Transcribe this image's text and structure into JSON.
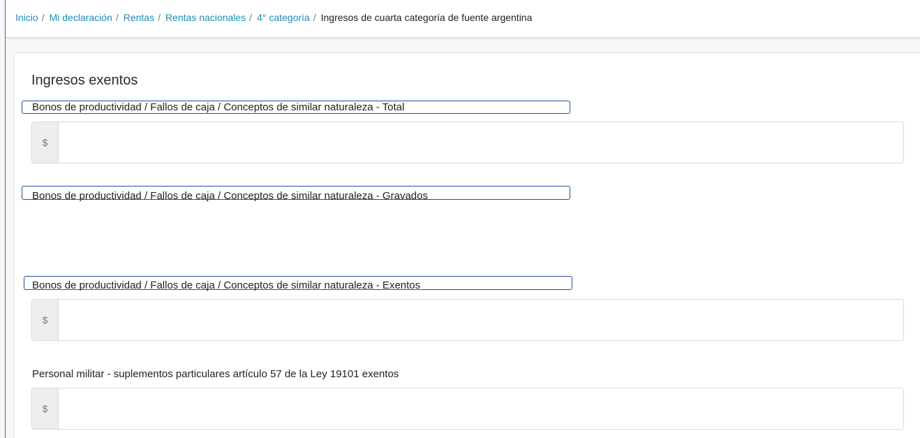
{
  "breadcrumb": {
    "links": [
      "Inicio",
      "Mi declaración",
      "Rentas",
      "Rentas nacionales",
      "4° categoría"
    ],
    "separator": "/",
    "current": "Ingresos de cuarta categoría de fuente argentina"
  },
  "section": {
    "title": "Ingresos exentos"
  },
  "fields": {
    "total": {
      "label": "Bonos de productividad / Fallos de caja / Conceptos de similar naturaleza - Total",
      "currency": "$",
      "value": ""
    },
    "gravados": {
      "label": "Bonos de productividad / Fallos de caja / Conceptos de similar naturaleza - Gravados"
    },
    "exentos": {
      "label": "Bonos de productividad / Fallos de caja / Conceptos de similar naturaleza - Exentos",
      "currency": "$",
      "value": ""
    },
    "militar": {
      "label": "Personal militar - suplementos particulares artículo 57 de la Ley 19101 exentos",
      "currency": "$",
      "value": ""
    }
  },
  "colors": {
    "link": "#1a8fb8",
    "label_outline": "#1f4e9e",
    "input_border": "#d9d9d9",
    "addon_bg": "#eeeeee"
  }
}
